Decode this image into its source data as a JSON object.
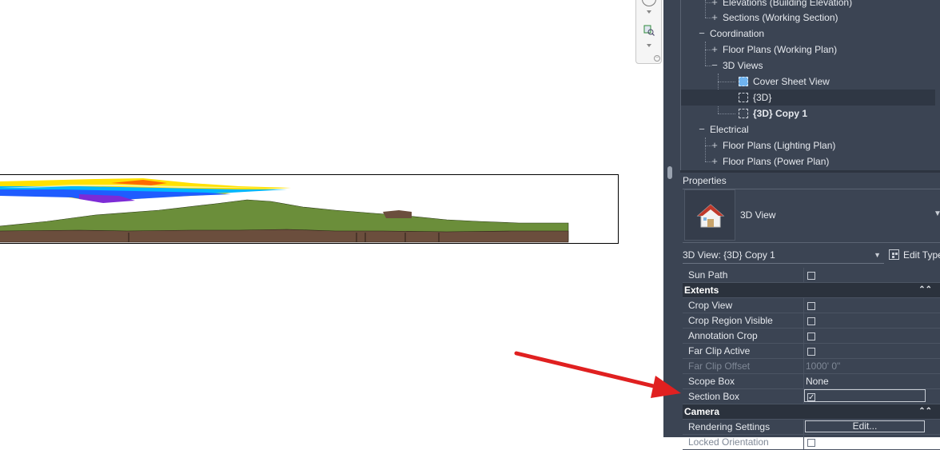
{
  "browser": {
    "items": [
      {
        "label": "Elevations (Building Elevation)",
        "sign": "+",
        "level": 2
      },
      {
        "label": "Sections (Working Section)",
        "sign": "+",
        "level": 2
      },
      {
        "label": "Coordination",
        "sign": "−",
        "level": 1
      },
      {
        "label": "Floor Plans (Working Plan)",
        "sign": "+",
        "level": 2
      },
      {
        "label": "3D Views",
        "sign": "−",
        "level": 2
      },
      {
        "label": "Cover Sheet View",
        "level": 3,
        "icon": "cover-sheet-view-icon"
      },
      {
        "label": "{3D}",
        "level": 3,
        "icon": "3d-view-icon"
      },
      {
        "label": "{3D} Copy 1",
        "level": 3,
        "icon": "3d-view-icon",
        "bold": true
      },
      {
        "label": "Electrical",
        "sign": "−",
        "level": 1
      },
      {
        "label": "Floor Plans (Lighting Plan)",
        "sign": "+",
        "level": 2
      },
      {
        "label": "Floor Plans (Power Plan)",
        "sign": "+",
        "level": 2
      }
    ]
  },
  "properties": {
    "title": "Properties",
    "type_name": "3D View",
    "instance_selector": "3D View: {3D} Copy 1",
    "edit_type_label": "Edit Type",
    "rows": {
      "sun_path": "Sun Path",
      "extents_group": "Extents",
      "crop_view": "Crop View",
      "crop_region_visible": "Crop Region Visible",
      "annotation_crop": "Annotation Crop",
      "far_clip_active": "Far Clip Active",
      "far_clip_offset": "Far Clip Offset",
      "far_clip_offset_value": "1000'  0\"",
      "scope_box": "Scope Box",
      "scope_box_value": "None",
      "section_box": "Section Box",
      "camera_group": "Camera",
      "rendering_settings": "Rendering Settings",
      "rendering_settings_button": "Edit...",
      "locked_orientation": "Locked Orientation"
    },
    "checked": {
      "sun_path": false,
      "crop_view": false,
      "crop_region_visible": false,
      "annotation_crop": false,
      "far_clip_active": false,
      "section_box": true,
      "locked_orientation": false
    }
  },
  "icons": {
    "house": "house-icon",
    "collapse": "chevron-double-up-icon",
    "dropdown": "chevron-down-icon",
    "edit_type": "edit-type-icon",
    "annotation": "red-arrow-annotation"
  },
  "colors": {
    "panel_bg": "#3b4453",
    "group_bg": "#2b323d",
    "annotation_arrow": "#e02020",
    "terrain": "#6b8e3a",
    "soil": "#6b4e3d"
  }
}
